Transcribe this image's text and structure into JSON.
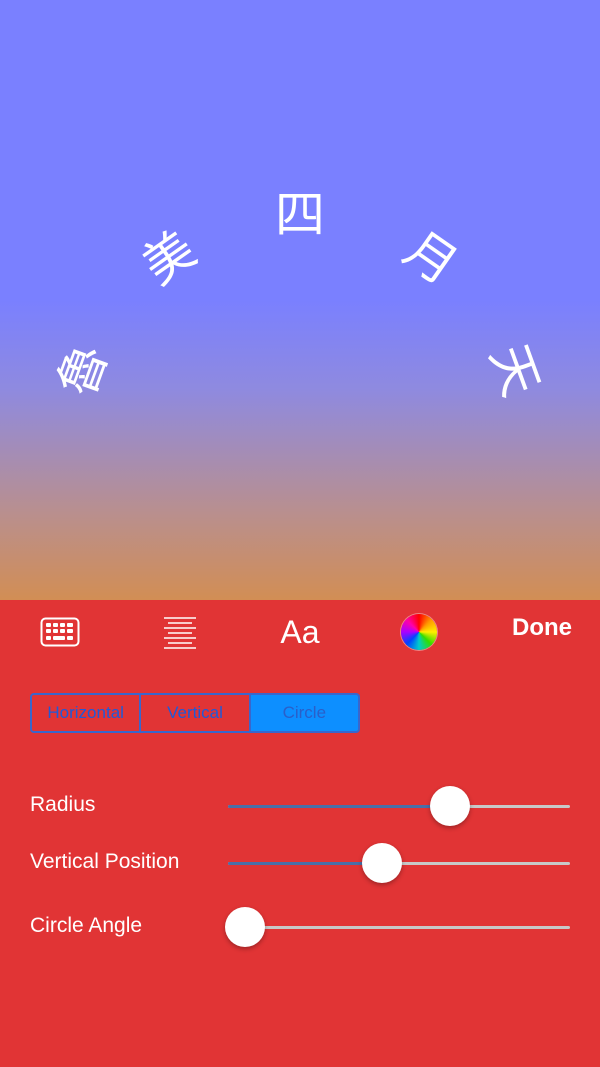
{
  "canvas": {
    "characters": [
      "魯",
      "美",
      "四",
      "月",
      "天"
    ]
  },
  "toolbar": {
    "keyboard_icon": "keyboard-icon",
    "align_icon": "text-align-icon",
    "font_label": "Aa",
    "color_icon": "color-wheel-icon",
    "done_label": "Done"
  },
  "layout_mode": {
    "options": [
      "Horizontal",
      "Vertical",
      "Circle"
    ],
    "selected": "Circle"
  },
  "sliders": [
    {
      "label": "Radius",
      "value": 0.65
    },
    {
      "label": "Vertical Position",
      "value": 0.45
    },
    {
      "label": "Circle Angle",
      "value": 0.05
    }
  ],
  "colors": {
    "panel_bg": "#e13435",
    "canvas_top": "#7a80ff",
    "canvas_bottom": "#d28e54",
    "segment_accent": "#0d8fff"
  }
}
